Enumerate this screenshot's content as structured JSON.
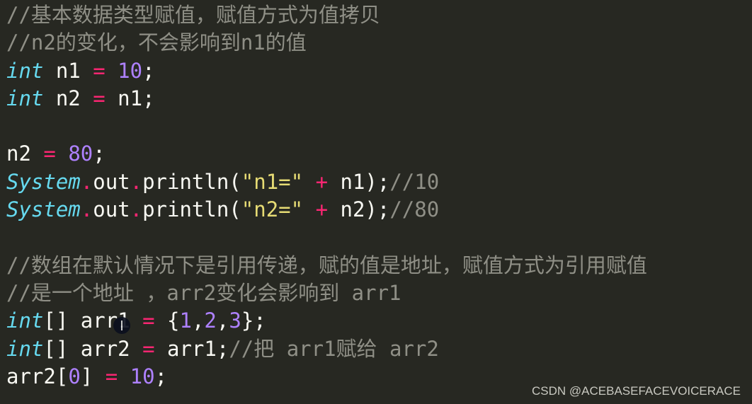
{
  "theme": {
    "background": "#272822",
    "comment": "#8f8f86",
    "keyword": "#66d9ef",
    "operator": "#f92672",
    "number": "#ae81ff",
    "string": "#e6db74",
    "text": "#f8f8f2"
  },
  "lines": [
    {
      "tokens": [
        {
          "type": "c",
          "text": "//基本数据类型赋值，赋值方式为值拷贝"
        }
      ]
    },
    {
      "tokens": [
        {
          "type": "c",
          "text": "//n2的变化，不会影响到n1的值"
        }
      ]
    },
    {
      "tokens": [
        {
          "type": "k",
          "text": "int"
        },
        {
          "type": "p",
          "text": " n1 "
        },
        {
          "type": "o",
          "text": "="
        },
        {
          "type": "p",
          "text": " "
        },
        {
          "type": "n",
          "text": "10"
        },
        {
          "type": "p",
          "text": ";"
        }
      ]
    },
    {
      "tokens": [
        {
          "type": "k",
          "text": "int"
        },
        {
          "type": "p",
          "text": " n2 "
        },
        {
          "type": "o",
          "text": "="
        },
        {
          "type": "p",
          "text": " n1;"
        }
      ]
    },
    {
      "tokens": []
    },
    {
      "tokens": [
        {
          "type": "p",
          "text": "n2 "
        },
        {
          "type": "o",
          "text": "="
        },
        {
          "type": "p",
          "text": " "
        },
        {
          "type": "n",
          "text": "80"
        },
        {
          "type": "p",
          "text": ";"
        }
      ]
    },
    {
      "tokens": [
        {
          "type": "k",
          "text": "System"
        },
        {
          "type": "o",
          "text": "."
        },
        {
          "type": "p",
          "text": "out"
        },
        {
          "type": "o",
          "text": "."
        },
        {
          "type": "p",
          "text": "println("
        },
        {
          "type": "s",
          "text": "\"n1=\""
        },
        {
          "type": "p",
          "text": " "
        },
        {
          "type": "o",
          "text": "+"
        },
        {
          "type": "p",
          "text": " n1);"
        },
        {
          "type": "c",
          "text": "//10"
        }
      ]
    },
    {
      "tokens": [
        {
          "type": "k",
          "text": "System"
        },
        {
          "type": "o",
          "text": "."
        },
        {
          "type": "p",
          "text": "out"
        },
        {
          "type": "o",
          "text": "."
        },
        {
          "type": "p",
          "text": "println("
        },
        {
          "type": "s",
          "text": "\"n2=\""
        },
        {
          "type": "p",
          "text": " "
        },
        {
          "type": "o",
          "text": "+"
        },
        {
          "type": "p",
          "text": " n2);"
        },
        {
          "type": "c",
          "text": "//80"
        }
      ]
    },
    {
      "tokens": []
    },
    {
      "tokens": [
        {
          "type": "c",
          "text": "//数组在默认情况下是引用传递，赋的值是地址，赋值方式为引用赋值"
        }
      ]
    },
    {
      "tokens": [
        {
          "type": "c",
          "text": "//是一个地址 ，arr2变化会影响到 arr1"
        }
      ]
    },
    {
      "tokens": [
        {
          "type": "k",
          "text": "int"
        },
        {
          "type": "p",
          "text": "[] arr1 "
        },
        {
          "type": "o",
          "text": "="
        },
        {
          "type": "p",
          "text": " {"
        },
        {
          "type": "n",
          "text": "1"
        },
        {
          "type": "p",
          "text": ","
        },
        {
          "type": "n",
          "text": "2"
        },
        {
          "type": "p",
          "text": ","
        },
        {
          "type": "n",
          "text": "3"
        },
        {
          "type": "p",
          "text": "};"
        }
      ]
    },
    {
      "tokens": [
        {
          "type": "k",
          "text": "int"
        },
        {
          "type": "p",
          "text": "[] arr2 "
        },
        {
          "type": "o",
          "text": "="
        },
        {
          "type": "p",
          "text": " arr1;"
        },
        {
          "type": "c",
          "text": "//把 arr1赋给 arr2"
        }
      ]
    },
    {
      "tokens": [
        {
          "type": "p",
          "text": "arr2["
        },
        {
          "type": "n",
          "text": "0"
        },
        {
          "type": "p",
          "text": "] "
        },
        {
          "type": "o",
          "text": "="
        },
        {
          "type": "p",
          "text": " "
        },
        {
          "type": "n",
          "text": "10"
        },
        {
          "type": "p",
          "text": ";"
        }
      ]
    }
  ],
  "watermark": "CSDN @ACEBASEFACEVOICERACE"
}
